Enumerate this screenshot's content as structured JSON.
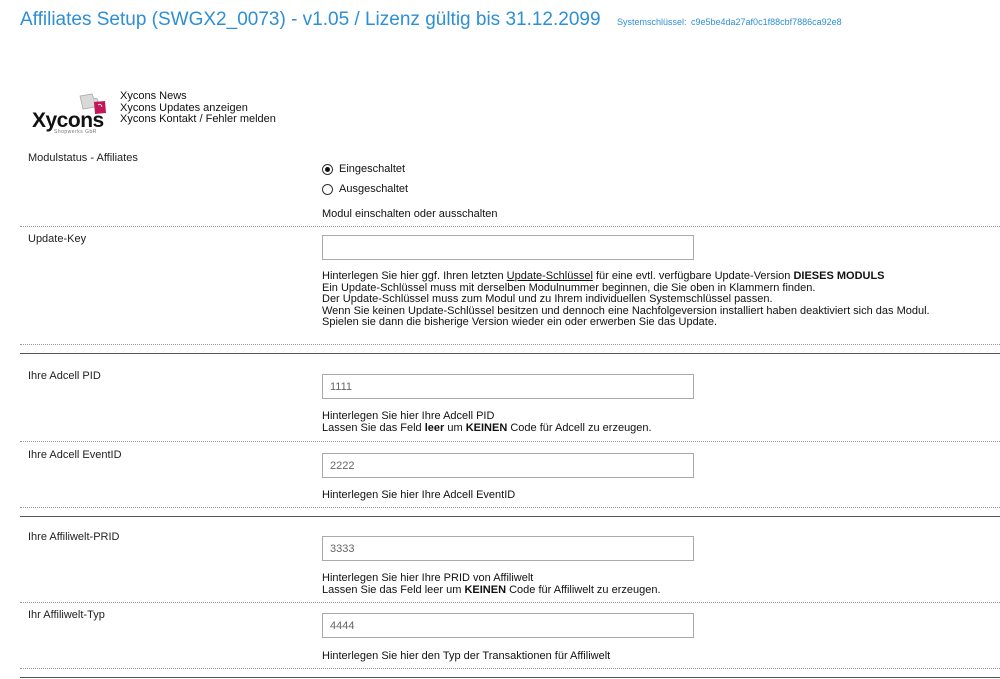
{
  "header": {
    "title": "Affiliates Setup (SWGX2_0073) - v1.05 / Lizenz gültig bis 31.12.2099",
    "syskey_label": "Systemschlüssel:",
    "syskey_value": "c9e5be4da27af0c1f88cbf7886ca92e8"
  },
  "logo": {
    "word": "Xycons",
    "tag": "Shopwerks GbR"
  },
  "links": [
    "Xycons News",
    "Xycons Updates anzeigen",
    "Xycons Kontakt / Fehler melden"
  ],
  "modulstatus": {
    "label": "Modulstatus - Affiliates",
    "options": [
      "Eingeschaltet",
      "Ausgeschaltet"
    ],
    "selected": "Eingeschaltet",
    "desc": "Modul einschalten oder ausschalten"
  },
  "update_key": {
    "label": "Update-Key",
    "value": "",
    "desc_pre": "Hinterlegen Sie hier ggf. Ihren letzten ",
    "desc_link": "Update-Schlüssel",
    "desc_mid": " für eine evtl. verfügbare Update-Version ",
    "desc_bold": "DIESES MODULS",
    "lines": [
      "Ein Update-Schlüssel muss mit derselben Modulnummer beginnen, die Sie oben in Klammern finden.",
      "Der Update-Schlüssel muss zum Modul und zu Ihrem individuellen Systemschlüssel passen.",
      "Wenn Sie keinen Update-Schlüssel besitzen und dennoch eine Nachfolgeversion installiert haben deaktiviert sich das Modul.",
      "Spielen sie dann die bisherige Version wieder ein oder erwerben Sie das Update."
    ]
  },
  "adcell_pid": {
    "label": "Ihre Adcell PID",
    "value": "1111",
    "desc1": "Hinterlegen Sie hier Ihre Adcell PID",
    "desc2_pre": "Lassen Sie das Feld ",
    "desc2_b1": "leer",
    "desc2_mid": " um ",
    "desc2_b2": "KEINEN",
    "desc2_post": " Code für Adcell zu erzeugen."
  },
  "adcell_event": {
    "label": "Ihre Adcell EventID",
    "value": "2222",
    "desc": "Hinterlegen Sie hier Ihre Adcell EventID"
  },
  "affiliwelt_prid": {
    "label": "Ihre Affiliwelt-PRID",
    "value": "3333",
    "desc1": "Hinterlegen Sie hier Ihre PRID von Affiliwelt",
    "desc2_pre": "Lassen Sie das Feld leer um ",
    "desc2_b": "KEINEN",
    "desc2_post": " Code für Affiliwelt zu erzeugen."
  },
  "affiliwelt_typ": {
    "label": "Ihr Affiliwelt-Typ",
    "value": "4444",
    "desc": "Hinterlegen Sie hier den Typ der Transaktionen für Affiliwelt"
  }
}
